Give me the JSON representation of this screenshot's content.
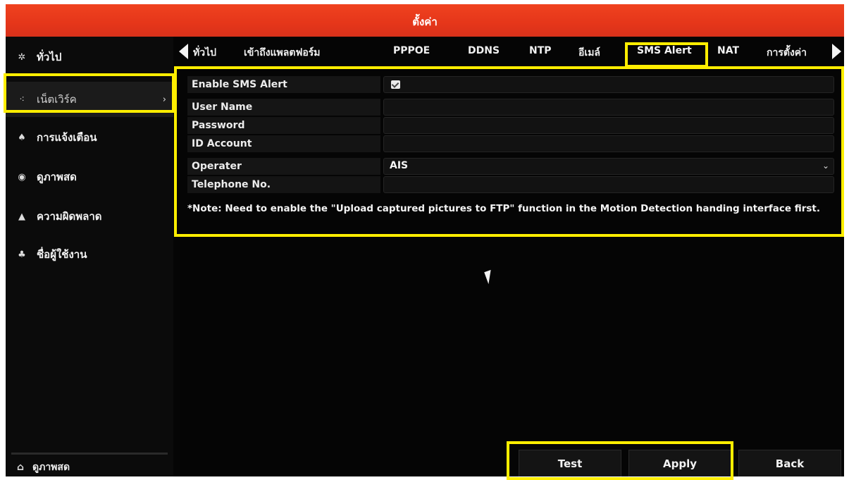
{
  "window": {
    "title": "ตั้งค่า"
  },
  "sidebar": {
    "items": [
      {
        "icon": "gear-icon",
        "label": "ทั่วไป"
      },
      {
        "icon": "network-icon",
        "label": "เน็ตเวิร์ค"
      },
      {
        "icon": "bell-icon",
        "label": "การแจ้งเตือน"
      },
      {
        "icon": "eye-icon",
        "label": "ดูภาพสด"
      },
      {
        "icon": "warning-icon",
        "label": "ความผิดพลาด"
      },
      {
        "icon": "users-icon",
        "label": "ชื่อผู้ใช้งาน"
      }
    ],
    "active_index": 1,
    "bottom": {
      "icon": "home-icon",
      "label": "ดูภาพสด"
    }
  },
  "tabs": {
    "items": [
      "ทั่วไป",
      "เข้าถึงแพลตฟอร์ม",
      "PPPOE",
      "DDNS",
      "NTP",
      "อีเมล์",
      "SMS Alert",
      "NAT",
      "การตั้งค่า"
    ],
    "active": "SMS Alert"
  },
  "form": {
    "enable_label": "Enable SMS Alert",
    "enable_checked": true,
    "username_label": "User Name",
    "username_value": "",
    "password_label": "Password",
    "password_value": "",
    "id_account_label": "ID Account",
    "id_account_value": "",
    "operator_label": "Operater",
    "operator_value": "AIS",
    "telephone_label": "Telephone No.",
    "telephone_value": "",
    "note": "*Note: Need to enable the \"Upload captured pictures to FTP\" function in the Motion Detection handing interface first."
  },
  "buttons": {
    "test": "Test",
    "apply": "Apply",
    "back": "Back"
  },
  "colors": {
    "title_bar": "#e5361a",
    "highlight": "#ffee00",
    "background": "#050505"
  }
}
